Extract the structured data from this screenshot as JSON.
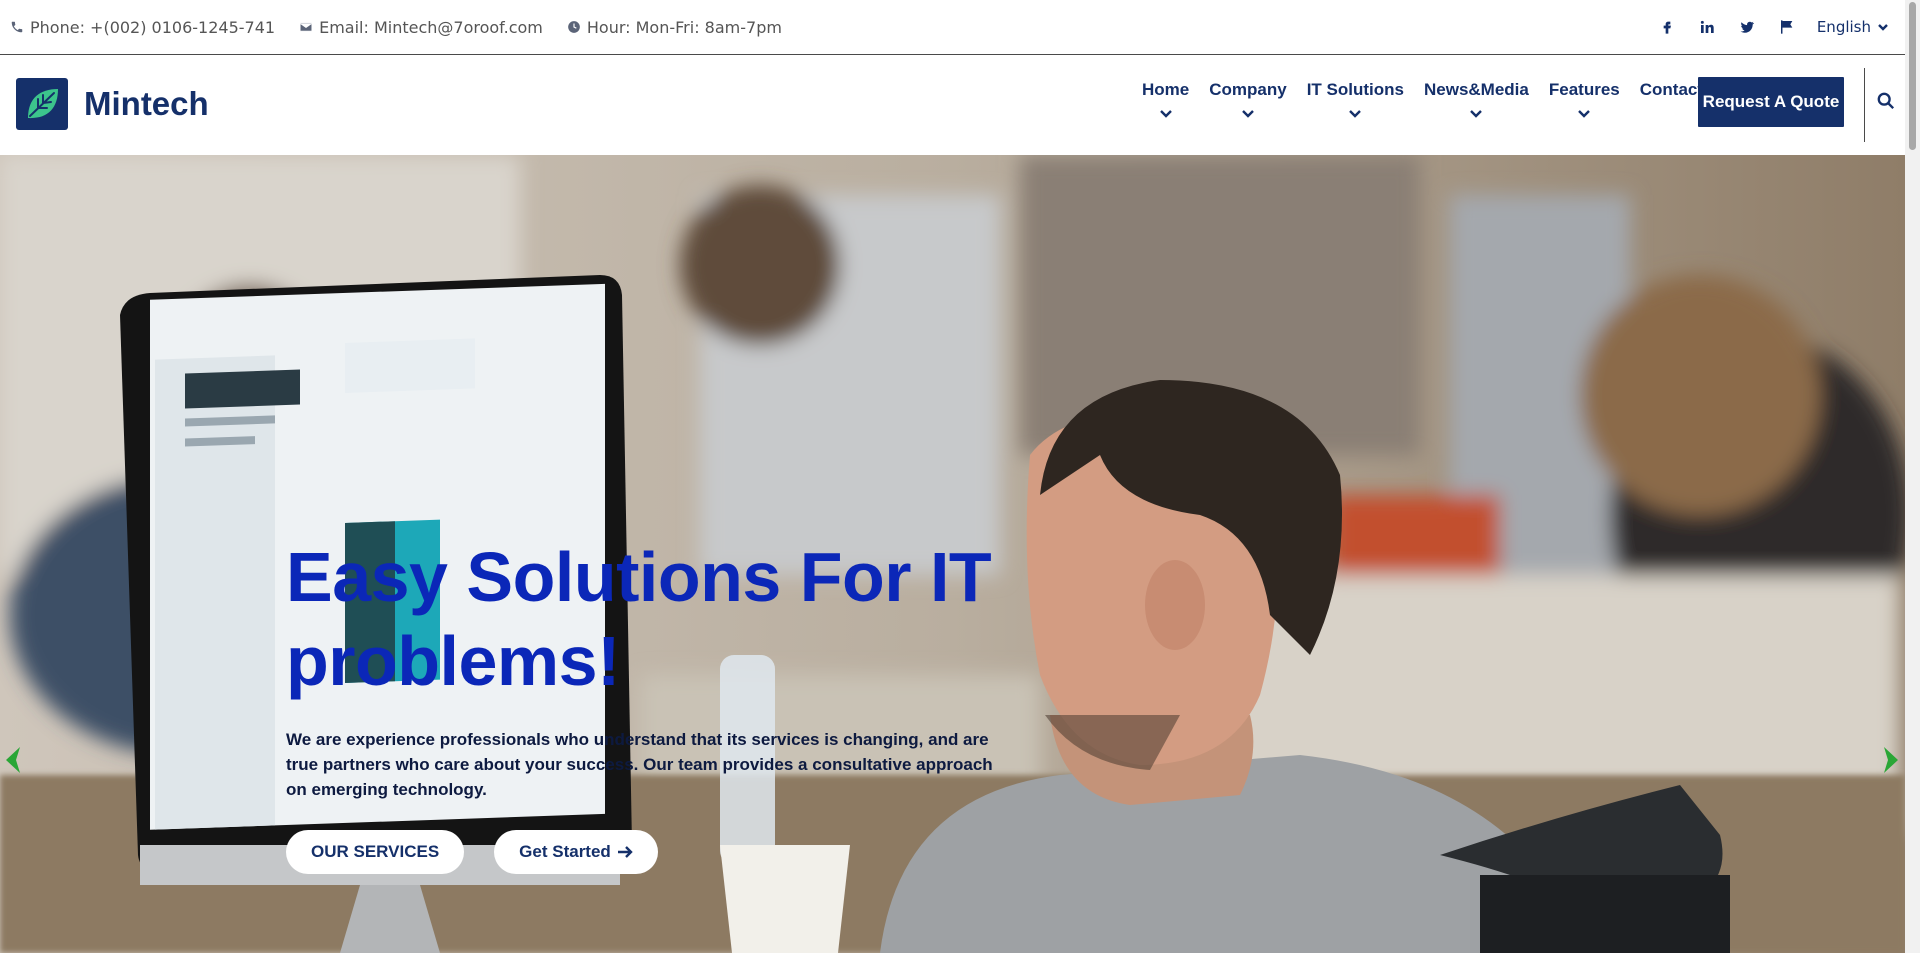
{
  "topbar": {
    "phone": "Phone: +(002) 0106-1245-741",
    "email": "Email: Mintech@7oroof.com",
    "hours": "Hour: Mon-Fri: 8am-7pm",
    "language": "English",
    "social": [
      "facebook-icon",
      "linkedin-icon",
      "twitter-icon",
      "flag-icon"
    ]
  },
  "header": {
    "logo_text": "Mintech",
    "nav": [
      {
        "label": "Home",
        "has_dropdown": true
      },
      {
        "label": "Company",
        "has_dropdown": true
      },
      {
        "label": "IT Solutions",
        "has_dropdown": true
      },
      {
        "label": "News&Media",
        "has_dropdown": true
      },
      {
        "label": "Features",
        "has_dropdown": true
      },
      {
        "label": "Contact",
        "has_dropdown": false
      }
    ],
    "cta_label": "Request A Quote",
    "search_icon": "search-icon"
  },
  "hero": {
    "title_line1": "Easy Solutions For IT",
    "title_line2": "problems!",
    "text_line1": "We are experience professionals who understand that its services is changing, and are",
    "text_line2": "true partners who care about your success. Our team provides a consultative approach",
    "text_line3": "on emerging technology.",
    "button_primary": "OUR SERVICES",
    "button_secondary": "Get Started",
    "colors": {
      "title": "#0b27b8",
      "arrows": "#2aa636",
      "brand": "#15306a"
    }
  }
}
